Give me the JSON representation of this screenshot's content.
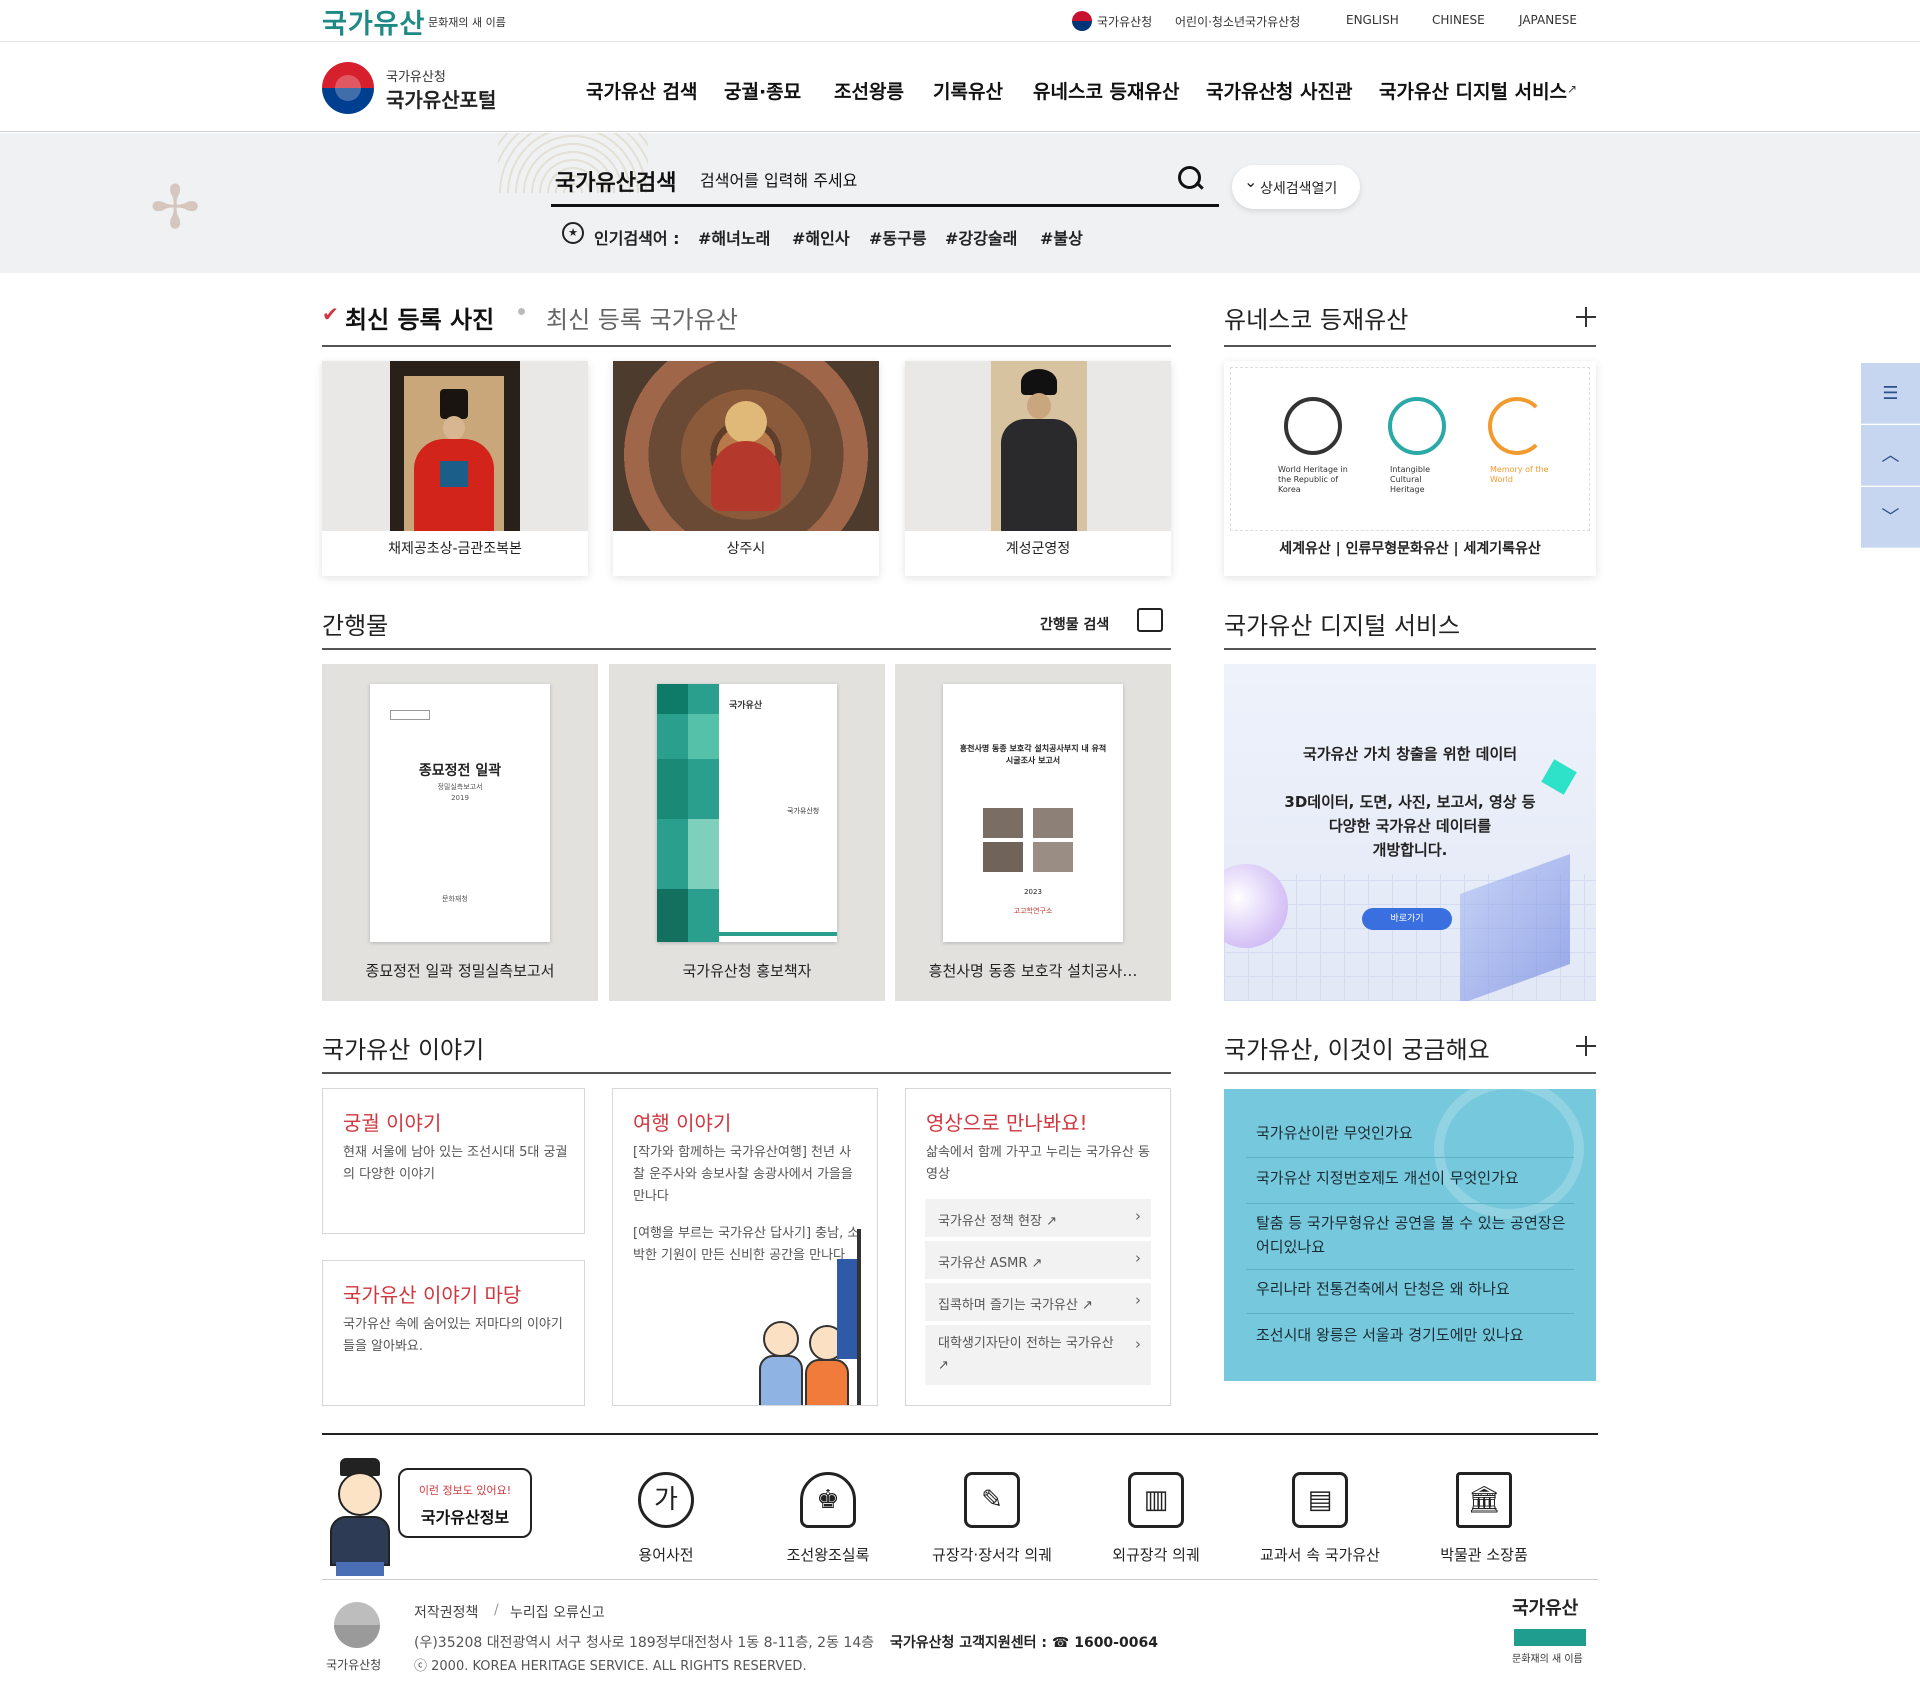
{
  "util": {
    "brand": "국가유산",
    "brand_sub": "문화재의 새 이름",
    "links": [
      "국가유산청",
      "어린이·청소년국가유산청",
      "ENGLISH",
      "CHINESE",
      "JAPANESE"
    ]
  },
  "header": {
    "logo_small": "국가유산청",
    "logo_big": "국가유산포털",
    "nav": [
      "국가유산 검색",
      "궁궐·종묘",
      "조선왕릉",
      "기록유산",
      "유네스코 등재유산",
      "국가유산청 사진관",
      "국가유산 디지털 서비스"
    ]
  },
  "search": {
    "title": "국가유산검색",
    "placeholder": "검색어를 입력해 주세요",
    "advanced_label": "상세검색열기",
    "popular_label": "인기검색어 :",
    "popular": [
      "#해녀노래",
      "#해인사",
      "#동구릉",
      "#강강술래",
      "#불상"
    ]
  },
  "photos": {
    "tab_active": "최신 등록 사진",
    "tab_inactive": "최신 등록 국가유산",
    "items": [
      "채제공초상-금관조복본",
      "상주시",
      "계성군영정"
    ]
  },
  "unesco": {
    "title": "유네스코 등재유산",
    "logos": [
      "World Heritage in the Republic of Korea",
      "Intangible Cultural Heritage",
      "Memory of the World"
    ],
    "caption": "세계유산 | 인류무형문화유산 | 세계기록유산",
    "colors": {
      "world": "#333333",
      "intangible": "#2aa9a6",
      "memory": "#f39a2e"
    }
  },
  "publications": {
    "title": "간행물",
    "search_label": "간행물 검색",
    "items": [
      {
        "caption": "종묘정전 일곽 정밀실측보고서",
        "cover_title": "종묘정전 일곽",
        "cover_sub": "정밀실측보고서",
        "cover_year": "2019",
        "cover_org": "문화재청"
      },
      {
        "caption": "국가유산청 홍보책자",
        "cover_title": "국가유산",
        "cover_org": "국가유산청"
      },
      {
        "caption": "흥천사명 동종 보호각 설치공사…",
        "cover_title": "흥천사명 동종 보호각 설치공사부지 내 유적 시굴조사 보고서",
        "cover_year": "2023",
        "cover_org": "고고학연구소"
      }
    ]
  },
  "digital": {
    "title": "국가유산 디지털 서비스",
    "headline": "국가유산 가치 창출을 위한 데이터",
    "body_1": "3D데이터, 도면, 사진, 보고서, 영상 등",
    "body_2": "다양한 국가유산 데이터를",
    "body_3": "개방합니다.",
    "button": "바로가기"
  },
  "stories": {
    "title": "국가유산 이야기",
    "palace_title": "궁궐 이야기",
    "palace_text": "현재 서울에 남아 있는 조선시대 5대 궁궐의 다양한 이야기",
    "travel_title": "여행 이야기",
    "travel_text_1": "[작가와 함께하는 국가유산여행] 천년 사찰 운주사와 송보사찰 송광사에서 가을을 만나다",
    "travel_text_2": "[여행을 부르는 국가유산 답사기] 충남, 소박한 기원이 만든 신비한 공간을 만나다",
    "madang_title": "국가유산 이야기 마당",
    "madang_text": "국가유산 속에 숨어있는 저마다의 이야기들을 알아봐요.",
    "video_title": "영상으로 만나봐요!",
    "video_text": "삶속에서 함께 가꾸고 누리는 국가유산 동영상",
    "videos": [
      "국가유산 정책 현장",
      "국가유산 ASMR",
      "집콕하며 즐기는 국가유산",
      "대학생기자단이 전하는 국가유산"
    ]
  },
  "faq": {
    "title": "국가유산, 이것이 궁금해요",
    "items": [
      "국가유산이란 무엇인가요",
      "국가유산 지정번호제도 개선이 무엇인가요",
      "탈춤 등 국가무형유산 공연을 볼 수 있는 공연장은 어디있나요",
      "우리나라 전통건축에서 단청은 왜 하나요",
      "조선시대 왕릉은 서울과 경기도에만 있나요"
    ]
  },
  "info": {
    "bubble_small": "이런 정보도 있어요!",
    "bubble_big": "국가유산정보",
    "links": [
      "용어사전",
      "조선왕조실록",
      "규장각·장서각 의궤",
      "외규장각 의궤",
      "교과서 속 국가유산",
      "박물관 소장품"
    ]
  },
  "footer": {
    "org": "국가유산청",
    "links": [
      "저작권정책",
      "누리집 오류신고"
    ],
    "sep": "/",
    "address": "(우)35208 대전광역시 서구 청사로 189정부대전청사 1동 8-11층, 2동 14층",
    "center": "국가유산청 고객지원센터 : ☎ 1600-0064",
    "copyright": "ⓒ 2000. KOREA HERITAGE SERVICE. ALL RIGHTS RESERVED.",
    "brand": "국가유산",
    "brand_sub": "문화재의 새 이름"
  }
}
